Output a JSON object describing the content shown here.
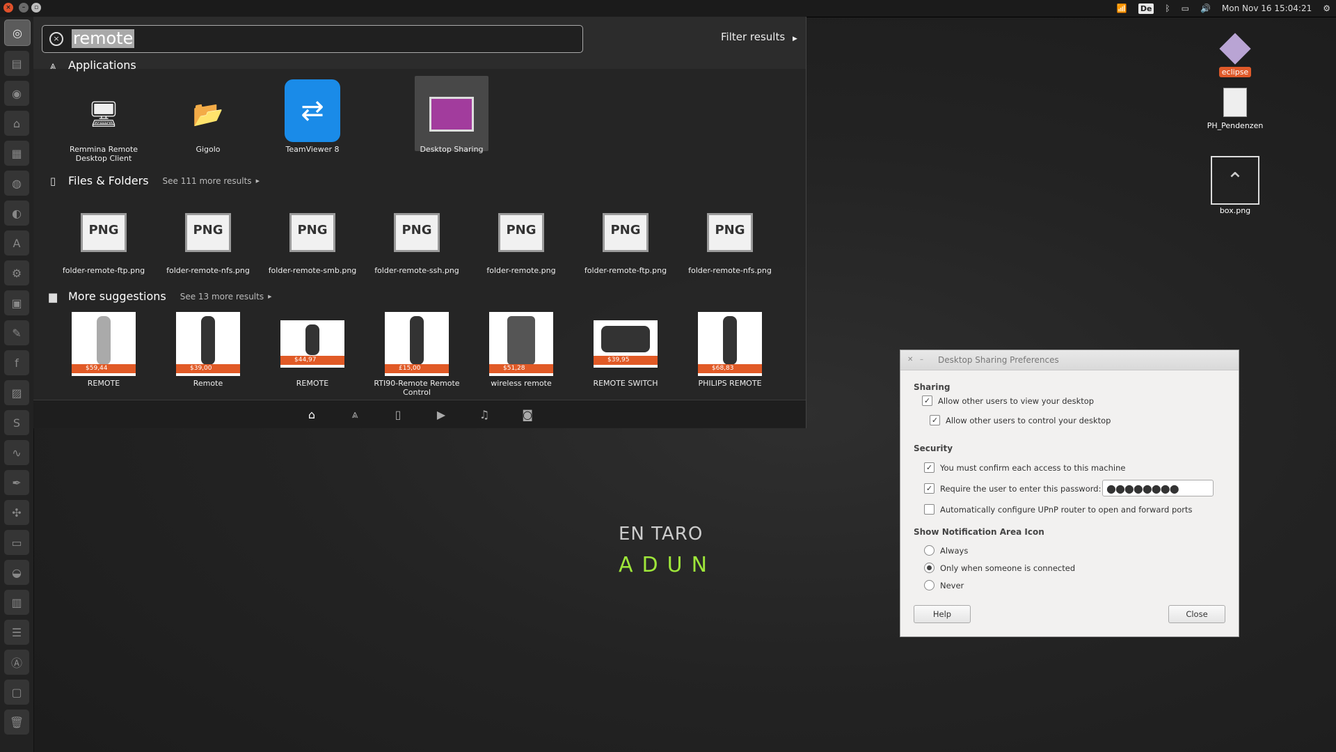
{
  "panel": {
    "clock": "Mon Nov 16 15:04:21",
    "keyboard_layout": "De"
  },
  "launcher": {
    "icons": [
      "ubuntu-logo-icon",
      "files-icon",
      "browser-icon",
      "home-folder-icon",
      "text-editor-icon",
      "chromium-icon",
      "firefox-icon",
      "software-center-icon",
      "settings-icon",
      "folder-icon",
      "tools-icon",
      "fonts-icon",
      "image-viewer-icon",
      "skype-icon",
      "system-monitor-icon",
      "inkscape-icon",
      "network-icon",
      "terminal-icon",
      "disk-icon",
      "archive-icon",
      "remote-icon",
      "software-icon",
      "display-icon",
      "trash-icon"
    ]
  },
  "dash": {
    "search_query": "remote",
    "filter_label": "Filter results",
    "categories": {
      "applications": "Applications",
      "files": "Files & Folders",
      "files_more": "See 111 more results",
      "suggestions": "More suggestions",
      "suggestions_more": "See 13 more results"
    },
    "apps": [
      {
        "name": "Remmina Remote Desktop Client",
        "icon": "remmina-icon"
      },
      {
        "name": "Gigolo",
        "icon": "gigolo-icon"
      },
      {
        "name": "TeamViewer 8",
        "icon": "teamviewer-icon"
      },
      {
        "name": "Desktop Sharing",
        "icon": "desktop-sharing-icon"
      }
    ],
    "files": [
      {
        "name": "folder-remote-ftp.png",
        "type": "PNG"
      },
      {
        "name": "folder-remote-nfs.png",
        "type": "PNG"
      },
      {
        "name": "folder-remote-smb.png",
        "type": "PNG"
      },
      {
        "name": "folder-remote-ssh.png",
        "type": "PNG"
      },
      {
        "name": "folder-remote.png",
        "type": "PNG"
      },
      {
        "name": "folder-remote-ftp.png",
        "type": "PNG"
      },
      {
        "name": "folder-remote-nfs.png",
        "type": "PNG"
      }
    ],
    "suggestions": [
      {
        "name": "REMOTE",
        "price": "$59,44"
      },
      {
        "name": "Remote",
        "price": "$39,00"
      },
      {
        "name": "REMOTE",
        "price": "$44,97"
      },
      {
        "name": "RTI90-Remote Remote Control",
        "price": "£15,00"
      },
      {
        "name": "wireless remote",
        "price": "$51,28"
      },
      {
        "name": "REMOTE SWITCH",
        "price": "$39,95"
      },
      {
        "name": "PHILIPS REMOTE",
        "price": "$68,83"
      }
    ],
    "lenses": [
      "home-lens-icon",
      "applications-lens-icon",
      "files-lens-icon",
      "video-lens-icon",
      "music-lens-icon",
      "photos-lens-icon"
    ]
  },
  "desktop": {
    "icons": [
      {
        "name": "eclipse"
      },
      {
        "name": "PH_Pendenzen"
      },
      {
        "name": "box.png"
      }
    ],
    "wallpaper_line1": "EN TARO",
    "wallpaper_line2": "ADUN"
  },
  "dialog": {
    "title": "Desktop Sharing Preferences",
    "sharing_header": "Sharing",
    "view_label": "Allow other users to view your desktop",
    "view_checked": true,
    "control_label": "Allow other users to control your desktop",
    "control_checked": true,
    "security_header": "Security",
    "confirm_label": "You must confirm each access to this machine",
    "confirm_checked": true,
    "password_label": "Require the user to enter this password:",
    "password_checked": true,
    "password_value": "●●●●●●●●",
    "upnp_label": "Automatically configure UPnP router to open and forward ports",
    "upnp_checked": false,
    "notify_header": "Show Notification Area Icon",
    "notify_options": [
      "Always",
      "Only when someone is connected",
      "Never"
    ],
    "notify_selected": "Only when someone is connected",
    "help_label": "Help",
    "close_label": "Close"
  }
}
